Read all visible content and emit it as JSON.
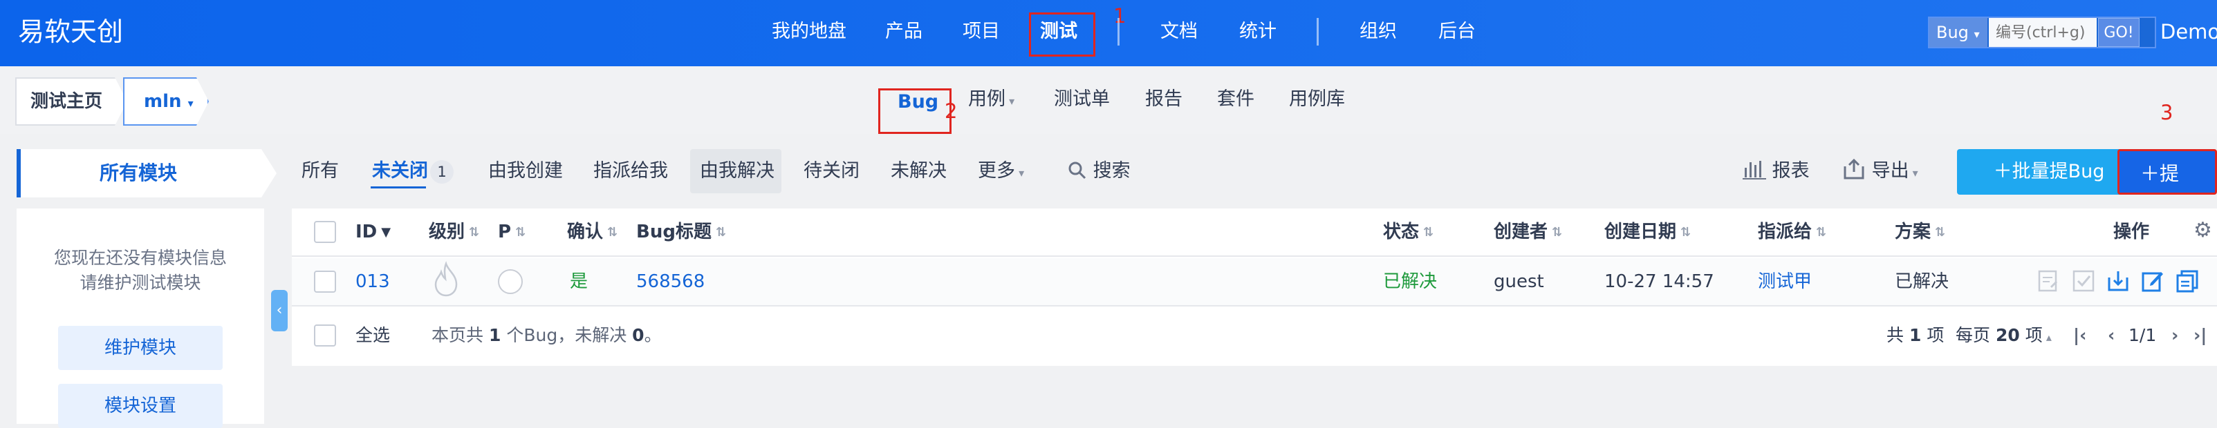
{
  "brand": "易软天创",
  "header": {
    "nav": [
      "我的地盘",
      "产品",
      "项目",
      "测试",
      "文档",
      "统计",
      "组织",
      "后台"
    ],
    "search": {
      "type": "Bug",
      "placeholder": "编号(ctrl+g)",
      "go": "GO!"
    },
    "user": "Demo"
  },
  "annotations": [
    "1",
    "2",
    "3"
  ],
  "breadcrumb": {
    "home": "测试主页",
    "product": "mln"
  },
  "subnav": [
    "Bug",
    "用例",
    "测试单",
    "报告",
    "套件",
    "用例库"
  ],
  "sidebar": {
    "title": "所有模块",
    "empty_text": [
      "您现在还没有模块信息",
      "请维护测试模块"
    ],
    "maintain": "维护模块",
    "settings": "模块设置"
  },
  "filters": {
    "all": "所有",
    "unclosed": "未关闭",
    "unclosed_count": "1",
    "created_by_me": "由我创建",
    "assigned_to_me": "指派给我",
    "resolved_by_me": "由我解决",
    "to_close": "待关闭",
    "unresolved": "未解决",
    "more": "更多",
    "search": "搜索"
  },
  "toolbar": {
    "report": "报表",
    "export": "导出",
    "batch_create": "批量提Bug",
    "create": "提Bug"
  },
  "table": {
    "headers": {
      "id": "ID",
      "severity": "级别",
      "pri": "P",
      "confirmed": "确认",
      "title": "Bug标题",
      "status": "状态",
      "creator": "创建者",
      "created": "创建日期",
      "assignee": "指派给",
      "resolution": "方案",
      "actions": "操作"
    },
    "rows": [
      {
        "id": "013",
        "confirmed": "是",
        "title": "568568",
        "status": "已解决",
        "creator": "guest",
        "created": "10-27 14:57",
        "assignee": "测试甲",
        "resolution": "已解决"
      }
    ]
  },
  "footer": {
    "select_all": "全选",
    "summary_prefix": "本页共",
    "summary_count": "1",
    "summary_mid": "个Bug，未解决",
    "summary_unresolved": "0",
    "summary_end": "。",
    "total_prefix": "共",
    "total": "1",
    "total_suffix": "项",
    "per_page_prefix": "每页",
    "per_page": "20",
    "per_page_suffix": "项",
    "page": "1/1"
  },
  "colors": {
    "primary": "#1565d6",
    "header": "#0c64eb",
    "success": "#1e9a3c",
    "annotation": "#e0251f"
  },
  "icons": [
    "search-icon",
    "report-icon",
    "export-icon",
    "plus-icon",
    "settings-icon",
    "fire-icon"
  ]
}
